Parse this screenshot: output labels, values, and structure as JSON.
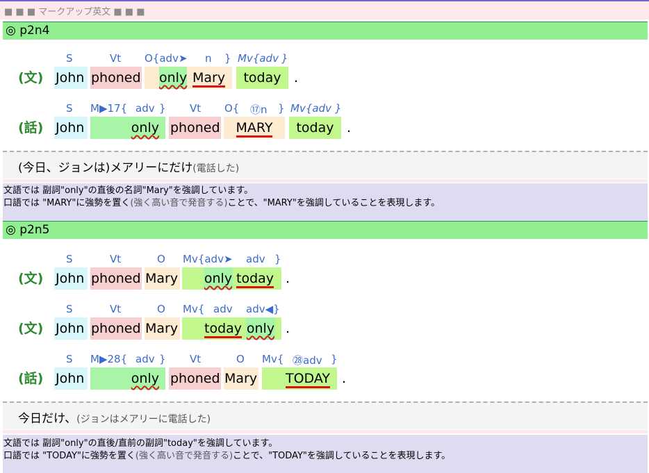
{
  "header": {
    "title": "■ ■ ■  マークアップ英文  ■ ■ ■"
  },
  "sections": [
    {
      "title": "◎ p2n4",
      "rows": [
        {
          "label": "(文)",
          "tags": [
            "S",
            "Vt",
            "O{adv➤",
            "n",
            "}",
            "Mv{adv",
            "}"
          ],
          "words": [
            "John",
            "phoned",
            "only",
            "Mary",
            "today"
          ],
          "dot": "."
        },
        {
          "label": "(話)",
          "tags": [
            "S",
            "M▶17{",
            "adv",
            "}",
            "Vt",
            "O{",
            "⑰n",
            "}",
            "Mv{adv",
            "}"
          ],
          "words": [
            "John",
            "only",
            "phoned",
            "MARY",
            "today"
          ],
          "dot": "."
        }
      ],
      "translation": {
        "main": "(今日、ジョンは)メアリーにだけ",
        "sub": "(電話した)"
      },
      "notes": [
        {
          "a": "文語では 副詞\"only\"の直後の名詞\"Mary\"を強調しています。",
          "b": "",
          "c": ""
        },
        {
          "a": "口語では \"MARY\"に強勢を置く",
          "b": "(強く高い音で発音する)",
          "c": "ことで、\"MARY\"を強調していることを表現します。"
        }
      ]
    },
    {
      "title": "◎ p2n5",
      "rows": [
        {
          "label": "(文)",
          "tags": [
            "S",
            "Vt",
            "O",
            "Mv{adv➤",
            "adv",
            "}"
          ],
          "words": [
            "John",
            "phoned",
            "Mary",
            "only",
            "today"
          ],
          "dot": "."
        },
        {
          "label": "(文)",
          "tags": [
            "S",
            "Vt",
            "O",
            "Mv{",
            "adv",
            "adv◀}"
          ],
          "words": [
            "John",
            "phoned",
            "Mary",
            "today",
            "only"
          ],
          "dot": "."
        },
        {
          "label": "(話)",
          "tags": [
            "S",
            "M▶28{",
            "adv",
            "}",
            "Vt",
            "O",
            "Mv{",
            "㉘adv",
            "}"
          ],
          "words": [
            "John",
            "only",
            "phoned",
            "Mary",
            "TODAY"
          ],
          "dot": "."
        }
      ],
      "translation": {
        "main": "今日だけ、",
        "sub": "(ジョンはメアリーに電話した)"
      },
      "notes": [
        {
          "a": "文語では 副詞\"only\"の直後/直前の副詞\"today\"を強調しています。",
          "b": "",
          "c": ""
        },
        {
          "a": "口語では \"TODAY\"に強勢を置く",
          "b": "(強く高い音で発音する)",
          "c": "ことで、\"TODAY\"を強調していることを表現します。"
        }
      ]
    }
  ]
}
